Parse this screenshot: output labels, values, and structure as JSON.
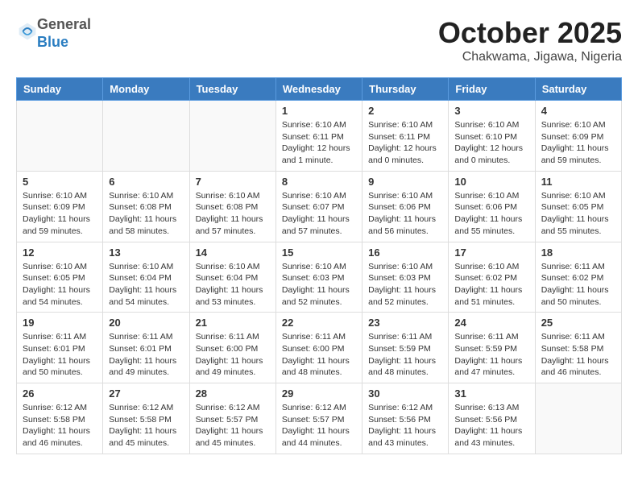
{
  "logo": {
    "general": "General",
    "blue": "Blue"
  },
  "header": {
    "month": "October 2025",
    "location": "Chakwama, Jigawa, Nigeria"
  },
  "weekdays": [
    "Sunday",
    "Monday",
    "Tuesday",
    "Wednesday",
    "Thursday",
    "Friday",
    "Saturday"
  ],
  "weeks": [
    [
      {
        "day": "",
        "info": ""
      },
      {
        "day": "",
        "info": ""
      },
      {
        "day": "",
        "info": ""
      },
      {
        "day": "1",
        "info": "Sunrise: 6:10 AM\nSunset: 6:11 PM\nDaylight: 12 hours\nand 1 minute."
      },
      {
        "day": "2",
        "info": "Sunrise: 6:10 AM\nSunset: 6:11 PM\nDaylight: 12 hours\nand 0 minutes."
      },
      {
        "day": "3",
        "info": "Sunrise: 6:10 AM\nSunset: 6:10 PM\nDaylight: 12 hours\nand 0 minutes."
      },
      {
        "day": "4",
        "info": "Sunrise: 6:10 AM\nSunset: 6:09 PM\nDaylight: 11 hours\nand 59 minutes."
      }
    ],
    [
      {
        "day": "5",
        "info": "Sunrise: 6:10 AM\nSunset: 6:09 PM\nDaylight: 11 hours\nand 59 minutes."
      },
      {
        "day": "6",
        "info": "Sunrise: 6:10 AM\nSunset: 6:08 PM\nDaylight: 11 hours\nand 58 minutes."
      },
      {
        "day": "7",
        "info": "Sunrise: 6:10 AM\nSunset: 6:08 PM\nDaylight: 11 hours\nand 57 minutes."
      },
      {
        "day": "8",
        "info": "Sunrise: 6:10 AM\nSunset: 6:07 PM\nDaylight: 11 hours\nand 57 minutes."
      },
      {
        "day": "9",
        "info": "Sunrise: 6:10 AM\nSunset: 6:06 PM\nDaylight: 11 hours\nand 56 minutes."
      },
      {
        "day": "10",
        "info": "Sunrise: 6:10 AM\nSunset: 6:06 PM\nDaylight: 11 hours\nand 55 minutes."
      },
      {
        "day": "11",
        "info": "Sunrise: 6:10 AM\nSunset: 6:05 PM\nDaylight: 11 hours\nand 55 minutes."
      }
    ],
    [
      {
        "day": "12",
        "info": "Sunrise: 6:10 AM\nSunset: 6:05 PM\nDaylight: 11 hours\nand 54 minutes."
      },
      {
        "day": "13",
        "info": "Sunrise: 6:10 AM\nSunset: 6:04 PM\nDaylight: 11 hours\nand 54 minutes."
      },
      {
        "day": "14",
        "info": "Sunrise: 6:10 AM\nSunset: 6:04 PM\nDaylight: 11 hours\nand 53 minutes."
      },
      {
        "day": "15",
        "info": "Sunrise: 6:10 AM\nSunset: 6:03 PM\nDaylight: 11 hours\nand 52 minutes."
      },
      {
        "day": "16",
        "info": "Sunrise: 6:10 AM\nSunset: 6:03 PM\nDaylight: 11 hours\nand 52 minutes."
      },
      {
        "day": "17",
        "info": "Sunrise: 6:10 AM\nSunset: 6:02 PM\nDaylight: 11 hours\nand 51 minutes."
      },
      {
        "day": "18",
        "info": "Sunrise: 6:11 AM\nSunset: 6:02 PM\nDaylight: 11 hours\nand 50 minutes."
      }
    ],
    [
      {
        "day": "19",
        "info": "Sunrise: 6:11 AM\nSunset: 6:01 PM\nDaylight: 11 hours\nand 50 minutes."
      },
      {
        "day": "20",
        "info": "Sunrise: 6:11 AM\nSunset: 6:01 PM\nDaylight: 11 hours\nand 49 minutes."
      },
      {
        "day": "21",
        "info": "Sunrise: 6:11 AM\nSunset: 6:00 PM\nDaylight: 11 hours\nand 49 minutes."
      },
      {
        "day": "22",
        "info": "Sunrise: 6:11 AM\nSunset: 6:00 PM\nDaylight: 11 hours\nand 48 minutes."
      },
      {
        "day": "23",
        "info": "Sunrise: 6:11 AM\nSunset: 5:59 PM\nDaylight: 11 hours\nand 48 minutes."
      },
      {
        "day": "24",
        "info": "Sunrise: 6:11 AM\nSunset: 5:59 PM\nDaylight: 11 hours\nand 47 minutes."
      },
      {
        "day": "25",
        "info": "Sunrise: 6:11 AM\nSunset: 5:58 PM\nDaylight: 11 hours\nand 46 minutes."
      }
    ],
    [
      {
        "day": "26",
        "info": "Sunrise: 6:12 AM\nSunset: 5:58 PM\nDaylight: 11 hours\nand 46 minutes."
      },
      {
        "day": "27",
        "info": "Sunrise: 6:12 AM\nSunset: 5:58 PM\nDaylight: 11 hours\nand 45 minutes."
      },
      {
        "day": "28",
        "info": "Sunrise: 6:12 AM\nSunset: 5:57 PM\nDaylight: 11 hours\nand 45 minutes."
      },
      {
        "day": "29",
        "info": "Sunrise: 6:12 AM\nSunset: 5:57 PM\nDaylight: 11 hours\nand 44 minutes."
      },
      {
        "day": "30",
        "info": "Sunrise: 6:12 AM\nSunset: 5:56 PM\nDaylight: 11 hours\nand 43 minutes."
      },
      {
        "day": "31",
        "info": "Sunrise: 6:13 AM\nSunset: 5:56 PM\nDaylight: 11 hours\nand 43 minutes."
      },
      {
        "day": "",
        "info": ""
      }
    ]
  ]
}
